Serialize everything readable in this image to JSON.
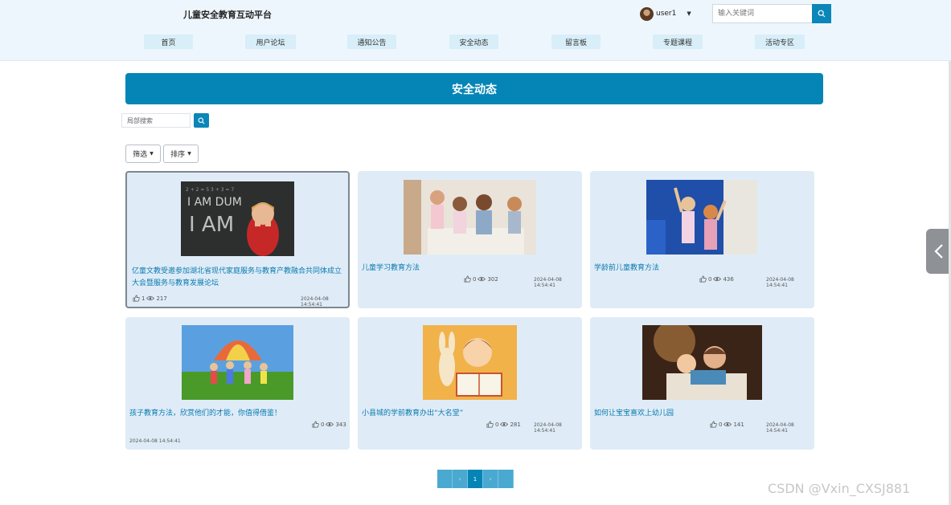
{
  "header": {
    "site_title": "儿童安全教育互动平台",
    "user_name": "user1",
    "search_placeholder": "输入关键词"
  },
  "nav": [
    {
      "label": "首页"
    },
    {
      "label": "用户论坛"
    },
    {
      "label": "通知公告"
    },
    {
      "label": "安全动态"
    },
    {
      "label": "留言板"
    },
    {
      "label": "专题课程"
    },
    {
      "label": "活动专区"
    }
  ],
  "banner": {
    "title": "安全动态"
  },
  "toolbar": {
    "local_search_placeholder": "局部搜索",
    "filter_label": "筛选",
    "sort_label": "排序"
  },
  "cards": [
    {
      "title": "亿童文教受邀参加湖北省现代家庭服务与教育产教融合共同体成立大会暨服务与教育发展论坛",
      "likes": "1",
      "views": "217",
      "date": "2024-04-08 14:54:41"
    },
    {
      "title": "儿童学习教育方法",
      "likes": "0",
      "views": "302",
      "date": "2024-04-08 14:54:41"
    },
    {
      "title": "学龄前儿童教育方法",
      "likes": "0",
      "views": "436",
      "date": "2024-04-08 14:54:41"
    },
    {
      "title": "孩子教育方法，欣赏他们的才能，你值得借鉴！",
      "likes": "0",
      "views": "343",
      "date": "2024-04-08 14:54:41"
    },
    {
      "title": "小县城的学前教育办出“大名堂”",
      "likes": "0",
      "views": "281",
      "date": "2024-04-08 14:54:41"
    },
    {
      "title": "如何让宝宝喜欢上幼儿园",
      "likes": "0",
      "views": "141",
      "date": "2024-04-08 14:54:41"
    }
  ],
  "pagination": {
    "prev": "‹",
    "current": "1",
    "next": "›"
  },
  "watermark": "CSDN @Vxin_CXSJ881",
  "colors": {
    "accent": "#0585b6",
    "card_bg": "#dfecf7",
    "header_bg": "#eef6fd"
  }
}
